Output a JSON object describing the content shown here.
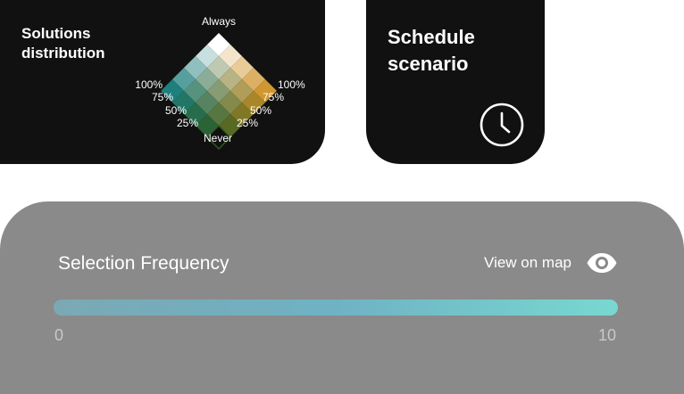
{
  "solutions_card": {
    "title": "Solutions distribution",
    "legend": {
      "top_label": "Always",
      "bottom_label": "Never",
      "left_ticks": [
        "100%",
        "75%",
        "50%",
        "25%"
      ],
      "right_ticks": [
        "100%",
        "75%",
        "50%",
        "25%"
      ],
      "top_color": "#ffffff",
      "left_color": "#1e7f7c",
      "right_color": "#d0962f",
      "bottom_color": "#2f5a1e"
    }
  },
  "schedule_card": {
    "title": "Schedule scenario",
    "icon": "clock-icon"
  },
  "frequency_panel": {
    "title": "Selection Frequency",
    "view_on_map_label": "View on map",
    "view_icon": "eye-icon",
    "scale_min": "0",
    "scale_max": "10",
    "gradient_start": "#7aa9b4",
    "gradient_middle": "#6fb2c4",
    "gradient_end": "#78d8d0"
  }
}
